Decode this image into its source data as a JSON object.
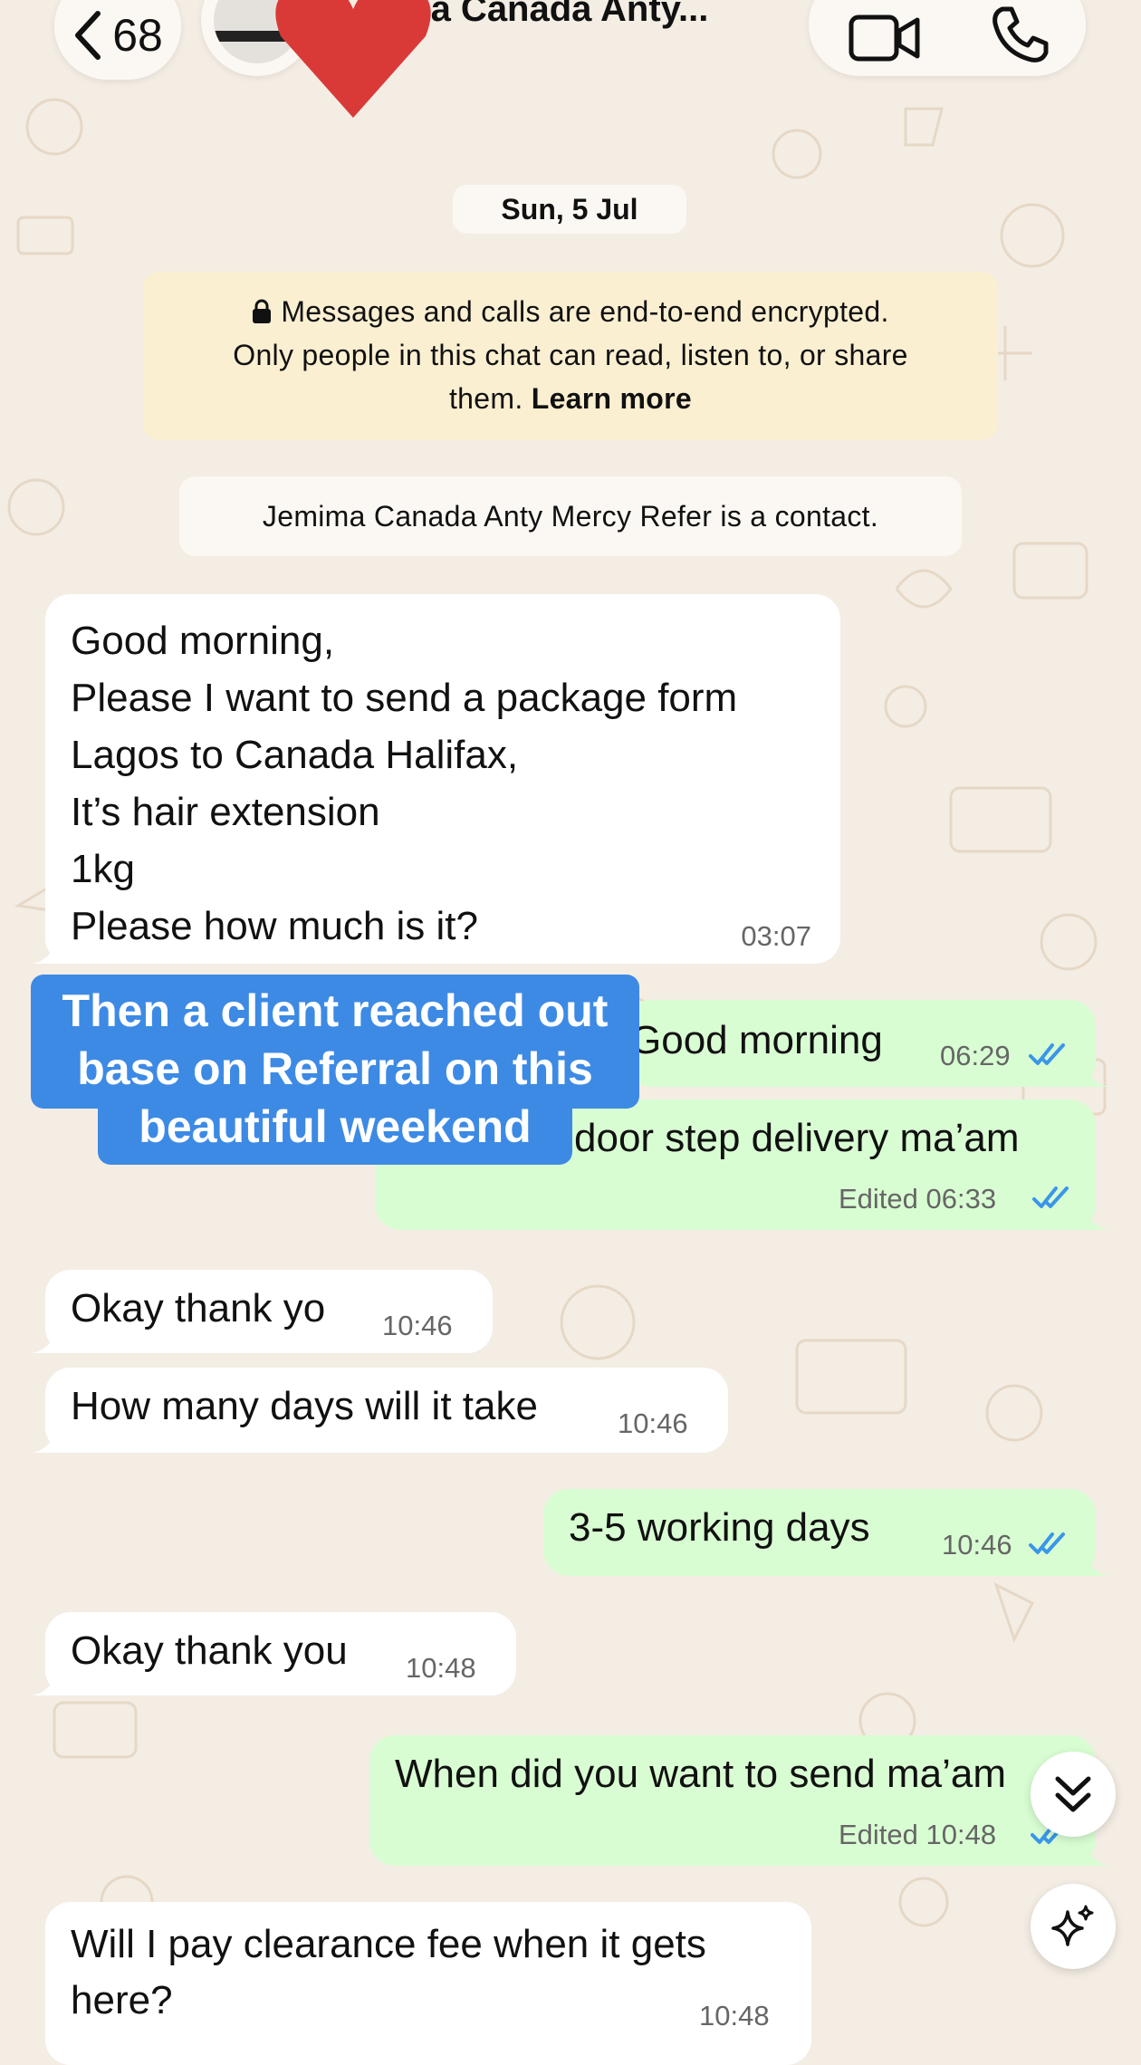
{
  "header": {
    "back_count": "68",
    "contact_name": "ma Canada Anty...",
    "video_call_icon": "video-call-icon",
    "voice_call_icon": "phone-icon"
  },
  "chat": {
    "date_chip": "Sun, 5 Jul",
    "encryption_notice": {
      "line1": "Messages and calls are end-to-end encrypted.",
      "line2": "Only people in this chat can read, listen to, or share",
      "line3_prefix": "them.",
      "learn_more": "Learn more"
    },
    "contact_notice": "Jemima Canada Anty Mercy Refer is a contact.",
    "messages": [
      {
        "lines": [
          "Good morning,",
          "Please I want to send a package form",
          "Lagos to Canada Halifax,",
          "It’s hair extension",
          "1kg",
          "Please how much is it?"
        ],
        "time": "03:07"
      },
      {
        "text": "Good morning",
        "time": "06:29"
      },
      {
        "text": "door step delivery ma’am",
        "time": "Edited 06:33"
      },
      {
        "text": "Okay thank yo",
        "time": "10:46"
      },
      {
        "text": "How many days will it take",
        "time": "10:46"
      },
      {
        "text": "3-5 working days",
        "time": "10:46"
      },
      {
        "text": "Okay thank you",
        "time": "10:48"
      },
      {
        "text": "When did you want to send ma’am",
        "time": "Edited 10:48"
      },
      {
        "lines": [
          "Will I pay clearance fee when it gets",
          "here?"
        ],
        "time": "10:48"
      }
    ]
  },
  "overlay_caption": {
    "line1": "Then a client reached out",
    "line2": "base on Referral on this",
    "line3": "beautiful weekend"
  },
  "colors": {
    "background": "#f4ede4",
    "incoming_bubble": "#ffffff",
    "outgoing_bubble": "#d9fdd3",
    "read_ticks": "#3b96e8",
    "caption_bg": "#3d8ae5"
  }
}
